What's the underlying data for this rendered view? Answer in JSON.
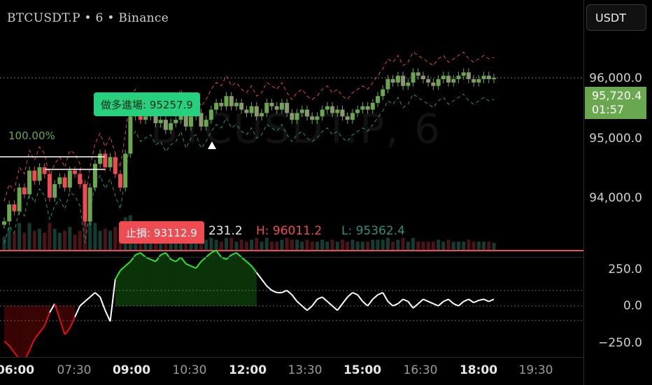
{
  "header": {
    "symbol": "BTCUSDT.P • 6 • Binance",
    "currency": "USDT"
  },
  "watermark": "BTCUSDT.P, 6",
  "price_axis": {
    "ticks": [
      "96,000.0",
      "95,000.0",
      "94,000.0"
    ],
    "last_price": "95,720.4",
    "countdown": "01:57"
  },
  "oscillator_axis": {
    "ticks": [
      "250.0",
      "0.0",
      "−250.0"
    ]
  },
  "time_axis": {
    "ticks": [
      {
        "label": "06:00",
        "bold": true
      },
      {
        "label": "07:30",
        "bold": false
      },
      {
        "label": "09:00",
        "bold": true
      },
      {
        "label": "10:30",
        "bold": false
      },
      {
        "label": "12:00",
        "bold": true
      },
      {
        "label": "13:30",
        "bold": false
      },
      {
        "label": "15:00",
        "bold": true
      },
      {
        "label": "16:30",
        "bold": false
      },
      {
        "label": "18:00",
        "bold": true
      },
      {
        "label": "19:30",
        "bold": false
      }
    ]
  },
  "annotations": {
    "percent": "100.00%",
    "long_entry": "做多進場: 95257.9",
    "stop_loss": "止損: 93112.9"
  },
  "ohlc": {
    "close_partial": "231.2",
    "high": "H: 96011.2",
    "low": "L: 95362.4"
  },
  "colors": {
    "up": "#6aa84f",
    "down": "#ef4b52",
    "band": "#e0474c",
    "band_low": "#2f8f7a",
    "osc_up": "#2ee62e",
    "osc_down": "#e01010",
    "osc_neutral": "#ffffff"
  },
  "chart_data": {
    "type": "candlestick",
    "y_range": [
      93200,
      96300
    ],
    "osc_range": [
      -300,
      300
    ],
    "closes": [
      93600,
      93850,
      93750,
      94100,
      94000,
      94350,
      94200,
      94400,
      94300,
      93950,
      94150,
      94250,
      94100,
      94350,
      94300,
      94150,
      93600,
      94100,
      94450,
      94600,
      94400,
      94550,
      94300,
      94100,
      94600,
      95150,
      95250,
      95100,
      95150,
      95200,
      95050,
      95100,
      94950,
      95050,
      95100,
      95250,
      95000,
      95150,
      95200,
      95000,
      95100,
      95250,
      95350,
      95300,
      95450,
      95300,
      95350,
      95250,
      95200,
      95300,
      95150,
      95200,
      95350,
      95300,
      95250,
      95350,
      95200,
      95100,
      95200,
      95250,
      95150,
      95100,
      95150,
      95250,
      95300,
      95200,
      95250,
      95150,
      95100,
      95200,
      95250,
      95300,
      95250,
      95350,
      95450,
      95550,
      95700,
      95650,
      95750,
      95600,
      95650,
      95800,
      95750,
      95700,
      95650,
      95600,
      95700,
      95750,
      95650,
      95700,
      95750,
      95800,
      95700,
      95650,
      95700,
      95750,
      95700,
      95720
    ],
    "oscillator": [
      -160,
      -180,
      -210,
      -240,
      -250,
      -200,
      -150,
      -120,
      -90,
      -30,
      10,
      -60,
      -130,
      -100,
      -50,
      0,
      20,
      40,
      60,
      40,
      -20,
      -70,
      120,
      160,
      180,
      200,
      230,
      240,
      220,
      210,
      200,
      230,
      240,
      210,
      200,
      220,
      190,
      180,
      170,
      200,
      220,
      240,
      250,
      220,
      210,
      230,
      240,
      220,
      200,
      180,
      150,
      120,
      90,
      70,
      60,
      60,
      70,
      50,
      20,
      0,
      -20,
      0,
      30,
      40,
      20,
      0,
      -20,
      10,
      40,
      60,
      50,
      20,
      0,
      30,
      50,
      60,
      20,
      0,
      10,
      30,
      20,
      -10,
      10,
      30,
      20,
      10,
      0,
      20,
      30,
      10,
      0,
      20,
      30,
      15,
      25,
      30,
      20,
      30
    ]
  }
}
